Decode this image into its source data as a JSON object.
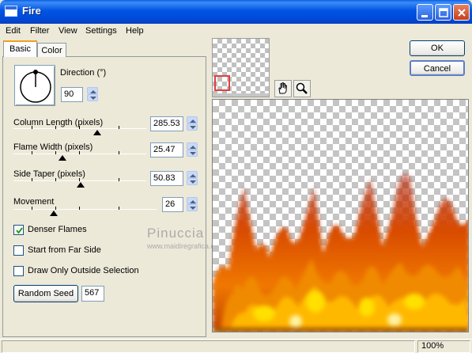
{
  "window": {
    "title": "Fire"
  },
  "menu": {
    "items": [
      "Edit",
      "Filter",
      "View",
      "Settings",
      "Help"
    ]
  },
  "tabs": {
    "basic": "Basic",
    "color": "Color"
  },
  "controls": {
    "direction": {
      "label": "Direction (°)",
      "value": "90"
    },
    "column_length": {
      "label": "Column Length (pixels)",
      "value": "285.53",
      "slider_fraction": 0.55
    },
    "flame_width": {
      "label": "Flame Width (pixels)",
      "value": "25.47",
      "slider_fraction": 0.36
    },
    "side_taper": {
      "label": "Side Taper (pixels)",
      "value": "50.83",
      "slider_fraction": 0.5
    },
    "movement": {
      "label": "Movement",
      "value": "26",
      "slider_fraction": 0.28
    },
    "denser_flames": {
      "label": "Denser Flames",
      "checked": true
    },
    "start_far_side": {
      "label": "Start from Far Side",
      "checked": false
    },
    "outside_selection": {
      "label": "Draw Only Outside Selection",
      "checked": false
    },
    "random_seed": {
      "button": "Random Seed",
      "value": "567"
    }
  },
  "buttons": {
    "ok": "OK",
    "cancel": "Cancel"
  },
  "watermark": {
    "name": "Pinuccia",
    "url": "www.maidiregrafica.eu"
  },
  "status": {
    "zoom": "100%"
  },
  "colors": {
    "fire_red": "#B01800",
    "fire_orange": "#F07800",
    "fire_yellow": "#FFE000",
    "titlebar": "#0054E3"
  }
}
